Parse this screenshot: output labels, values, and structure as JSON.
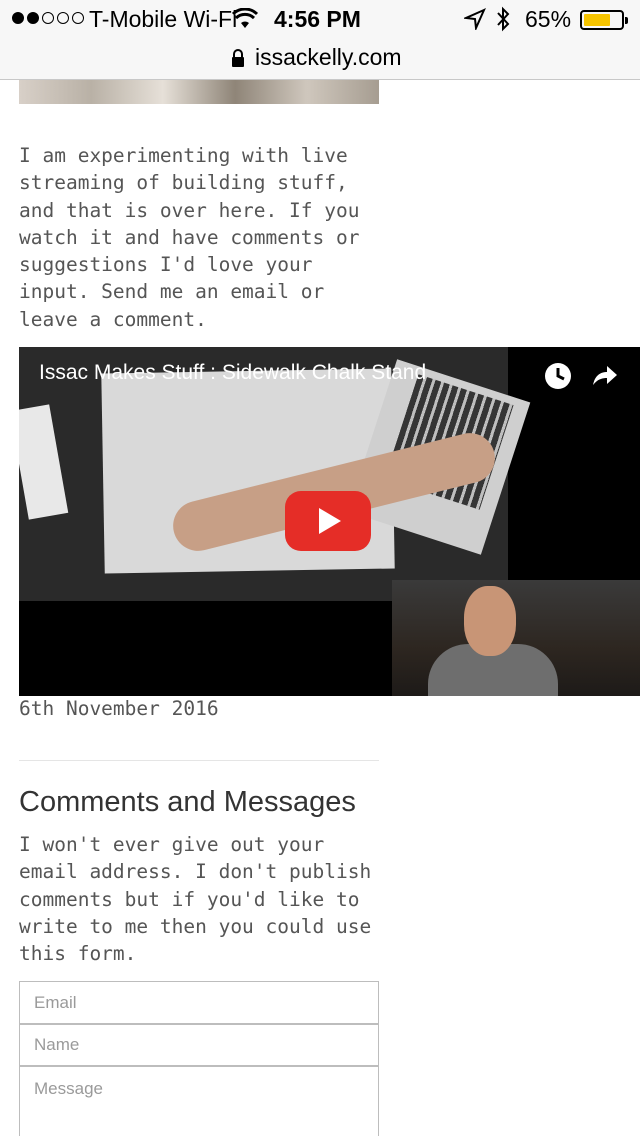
{
  "statusbar": {
    "carrier": "T-Mobile Wi-Fi",
    "time": "4:56 PM",
    "battery_pct": "65%",
    "battery_level": 0.65,
    "signal_bars_filled": 2,
    "icons": [
      "wifi-icon",
      "location-arrow-icon",
      "bluetooth-icon",
      "battery-icon"
    ]
  },
  "urlbar": {
    "url": "issackelly.com",
    "icon": "lock-icon"
  },
  "post": {
    "intro_text": "I am experimenting with live streaming of building stuff, and that is over here. If you watch it and have comments or suggestions I'd love your input. Send me an email or leave a comment.",
    "video": {
      "title": "Issac Makes Stuff : Sidewalk Chalk Stand",
      "icons": [
        "clock-icon",
        "share-icon",
        "play-icon"
      ]
    },
    "date": "6th November 2016"
  },
  "comments": {
    "heading": "Comments and Messages",
    "text": "I won't ever give out your email address. I don't publish comments but if you'd like to write to me then you could use this form.",
    "email_placeholder": "Email",
    "name_placeholder": "Name",
    "message_placeholder": "Message"
  },
  "colors": {
    "youtube_red": "#e52d27",
    "battery_yellow": "#f6c400",
    "text_gray": "#555555"
  }
}
